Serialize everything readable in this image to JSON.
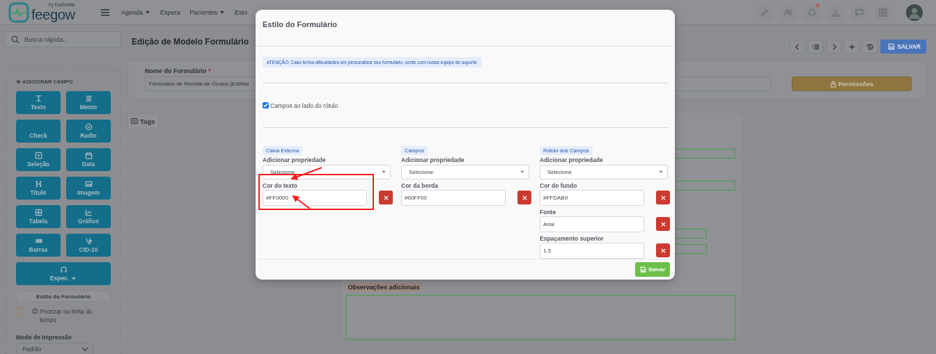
{
  "topbar": {
    "logo": "feegow",
    "logo_sub": "by Doctoralia",
    "nav": [
      {
        "label": "Agenda",
        "dropdown": true
      },
      {
        "label": "Espera",
        "dropdown": false
      },
      {
        "label": "Pacientes",
        "dropdown": true
      },
      {
        "label": "Esto",
        "dropdown": false
      }
    ],
    "icons": [
      {
        "kind": "pen",
        "badge": false
      },
      {
        "kind": "users",
        "badge": false
      },
      {
        "kind": "bell",
        "badge": true
      },
      {
        "kind": "chart",
        "badge": false
      },
      {
        "kind": "chat",
        "badge": false
      },
      {
        "kind": "grid",
        "badge": false
      }
    ]
  },
  "sidebar": {
    "search_placeholder": "Busca rápida...",
    "add_field_title": "ADICIONAR CAMPO",
    "field_buttons": [
      {
        "label": "Texto",
        "kind": "text"
      },
      {
        "label": "Memo",
        "kind": "memo"
      },
      {
        "label": "Check",
        "kind": "check"
      },
      {
        "label": "Radio",
        "kind": "radio"
      },
      {
        "label": "Seleção",
        "kind": "select"
      },
      {
        "label": "Data",
        "kind": "date"
      },
      {
        "label": "Título",
        "kind": "heading"
      },
      {
        "label": "Imagem",
        "kind": "image"
      },
      {
        "label": "Tabela",
        "kind": "table"
      },
      {
        "label": "Gráfico",
        "kind": "chart"
      },
      {
        "label": "Barras",
        "kind": "barcode"
      },
      {
        "label": "CID-10",
        "kind": "stethoscope"
      },
      {
        "label": "Espec.",
        "kind": "headset"
      }
    ],
    "style_button": "Estilo do Formulário",
    "prioritize": {
      "label": "Priorizar na linha do tempo",
      "checked": false
    },
    "print_mode": {
      "label": "Modo de Impressão",
      "value": "Padrão"
    }
  },
  "page": {
    "title": "Edição de Modelo Formulário",
    "save_button": "SALVAR",
    "form_name": {
      "label": "Nome do Formulário",
      "required_mark": "*",
      "value": "Formulário de Receita de Óculos (Estiliza"
    },
    "permissions_button": "Permissões",
    "tags_button": "Tags",
    "preview": {
      "notes_label": "Observações adicionais"
    }
  },
  "modal": {
    "title": "Estilo do Formulário",
    "alert": "ATENÇÃO: Caso tenha dificuldades em personalizar seu formulário, conte com nossa equipe de suporte.",
    "side_by_side": {
      "label": "Campos ao lado do rótulo",
      "checked": true
    },
    "columns": [
      {
        "tag": "Caixa Externa",
        "add_label": "Adicionar propriedade",
        "select_value": "Selecione",
        "properties": [
          {
            "label": "Cor do texto",
            "value": "#FF0000"
          }
        ]
      },
      {
        "tag": "Campos",
        "add_label": "Adicionar propriedade",
        "select_value": "Selecione",
        "properties": [
          {
            "label": "Cor da borda",
            "value": "#00FF00"
          }
        ]
      },
      {
        "tag": "Rótulo dos Campos",
        "add_label": "Adicionar propriedade",
        "select_value": "Selecione",
        "properties": [
          {
            "label": "Cor do fundo",
            "value": "#FFDAB9"
          },
          {
            "label": "Fonte",
            "value": "Arial"
          },
          {
            "label": "Espaçamento superior",
            "value": "1,5"
          }
        ]
      }
    ],
    "save_button": "Salvar"
  }
}
